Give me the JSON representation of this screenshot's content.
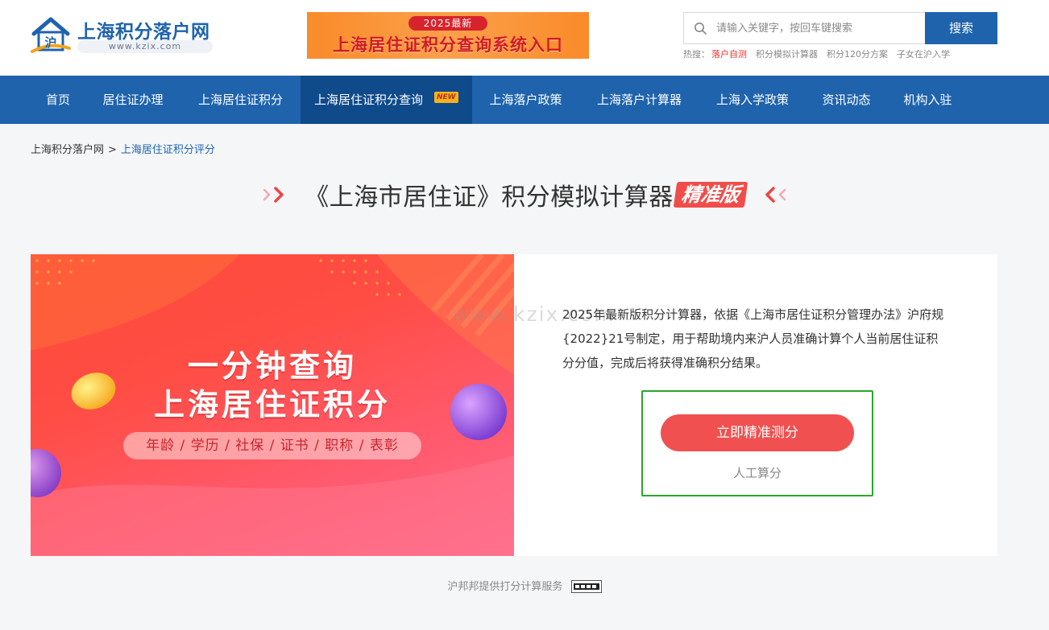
{
  "header": {
    "logo_title": "上海积分落户网",
    "logo_url": "www.kzix.com",
    "logo_mark_text": "沪",
    "banner_tag": "2025最新",
    "banner_text": "上海居住证积分查询系统入口",
    "search_placeholder": "请输入关键字，按回车键搜索",
    "search_button": "搜索",
    "hot_label": "热搜：",
    "hot_items": [
      "落户自测",
      "积分模拟计算器",
      "积分120分方案",
      "子女在沪入学"
    ]
  },
  "nav": {
    "items": [
      "首页",
      "居住证办理",
      "上海居住证积分",
      "上海居住证积分查询",
      "上海落户政策",
      "上海落户计算器",
      "上海入学政策",
      "资讯动态",
      "机构入驻"
    ],
    "active_index": 3,
    "badge": "NEW"
  },
  "breadcrumb": {
    "home": "上海积分落户网",
    "separator": ">",
    "current": "上海居住证积分评分"
  },
  "title": {
    "text": "《上海市居住证》积分模拟计算器",
    "badge": "精准版"
  },
  "promo": {
    "line1": "一分钟查询",
    "line2": "上海居住证积分",
    "tags": "年龄 / 学历 / 社保 / 证书 / 职称 / 表彰"
  },
  "main": {
    "description": "2025年最新版积分计算器，依据《上海市居住证积分管理办法》沪府规{2022}21号制定，用于帮助境内来沪人员准确计算个人当前居住证积分分值，完成后将获得准确积分结果。",
    "watermark": "www.kzix.com",
    "cta_button": "立即精准测分",
    "manual_link": "人工算分"
  },
  "footer": {
    "note": "沪邦邦提供打分计算服务"
  },
  "colors": {
    "brand_blue": "#1f63ad",
    "nav_active": "#0f4a8a",
    "cta_red": "#f05050",
    "highlight_green": "#2aa52a"
  }
}
